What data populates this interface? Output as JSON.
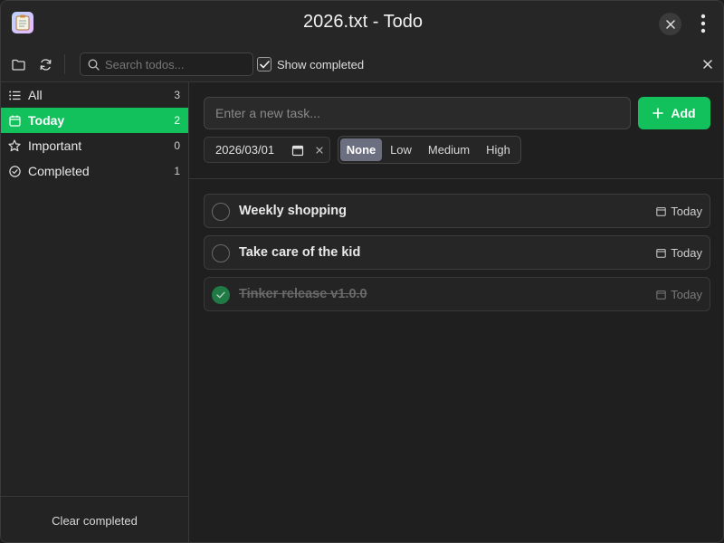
{
  "window": {
    "title": "2026.txt - Todo"
  },
  "toolbar": {
    "search_placeholder": "Search todos...",
    "show_completed_label": "Show completed",
    "show_completed_checked": true
  },
  "sidebar": {
    "items": [
      {
        "label": "All",
        "count": "3",
        "icon": "list-icon"
      },
      {
        "label": "Today",
        "count": "2",
        "icon": "calendar-icon",
        "active": true
      },
      {
        "label": "Important",
        "count": "0",
        "icon": "star-icon"
      },
      {
        "label": "Completed",
        "count": "1",
        "icon": "check-circle-icon"
      }
    ],
    "clear_completed_label": "Clear completed"
  },
  "main": {
    "new_task_placeholder": "Enter a new task...",
    "add_label": "Add",
    "date_value": "2026/03/01",
    "priority_options": [
      "None",
      "Low",
      "Medium",
      "High"
    ],
    "priority_selected": "None",
    "todos": [
      {
        "title": "Weekly shopping",
        "due": "Today",
        "done": false
      },
      {
        "title": "Take care of the kid",
        "due": "Today",
        "done": false
      },
      {
        "title": "Tinker release v1.0.0",
        "due": "Today",
        "done": true
      }
    ]
  },
  "colors": {
    "accent": "#12c05c",
    "background": "#1e1e1e",
    "selected_priority": "#6b6f80"
  }
}
